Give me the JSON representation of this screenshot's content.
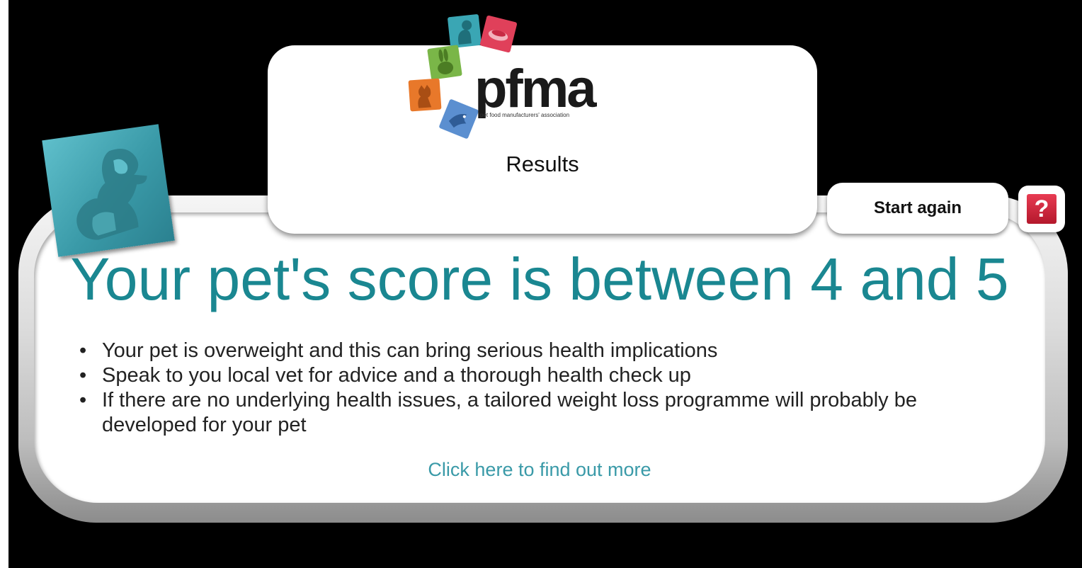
{
  "logo": {
    "wordmark": "pfma",
    "tagline": "pet food manufacturers' association",
    "tiles": [
      {
        "icon": "dog-icon",
        "color": "#3aa6b4"
      },
      {
        "icon": "food-bowl-icon",
        "color": "#e0405a"
      },
      {
        "icon": "rabbit-icon",
        "color": "#7ab648"
      },
      {
        "icon": "cat-icon",
        "color": "#e8782a"
      },
      {
        "icon": "bird-icon",
        "color": "#5b8fd0"
      }
    ]
  },
  "header": {
    "title": "Results"
  },
  "buttons": {
    "start_again": "Start again",
    "help": "?"
  },
  "result": {
    "score_heading": "Your pet's score is between 4 and 5",
    "bullet": "•",
    "advice": [
      "Your pet is overweight and this can bring serious health implications",
      "Speak to you local vet for advice and a thorough health check up",
      "If there are no underlying health issues, a tailored weight loss programme will probably be developed for your pet"
    ],
    "link": "Click here to find out more"
  },
  "colors": {
    "accent": "#1a8791",
    "link": "#3a9aa8",
    "help": "#c8203a",
    "background": "#000000"
  }
}
